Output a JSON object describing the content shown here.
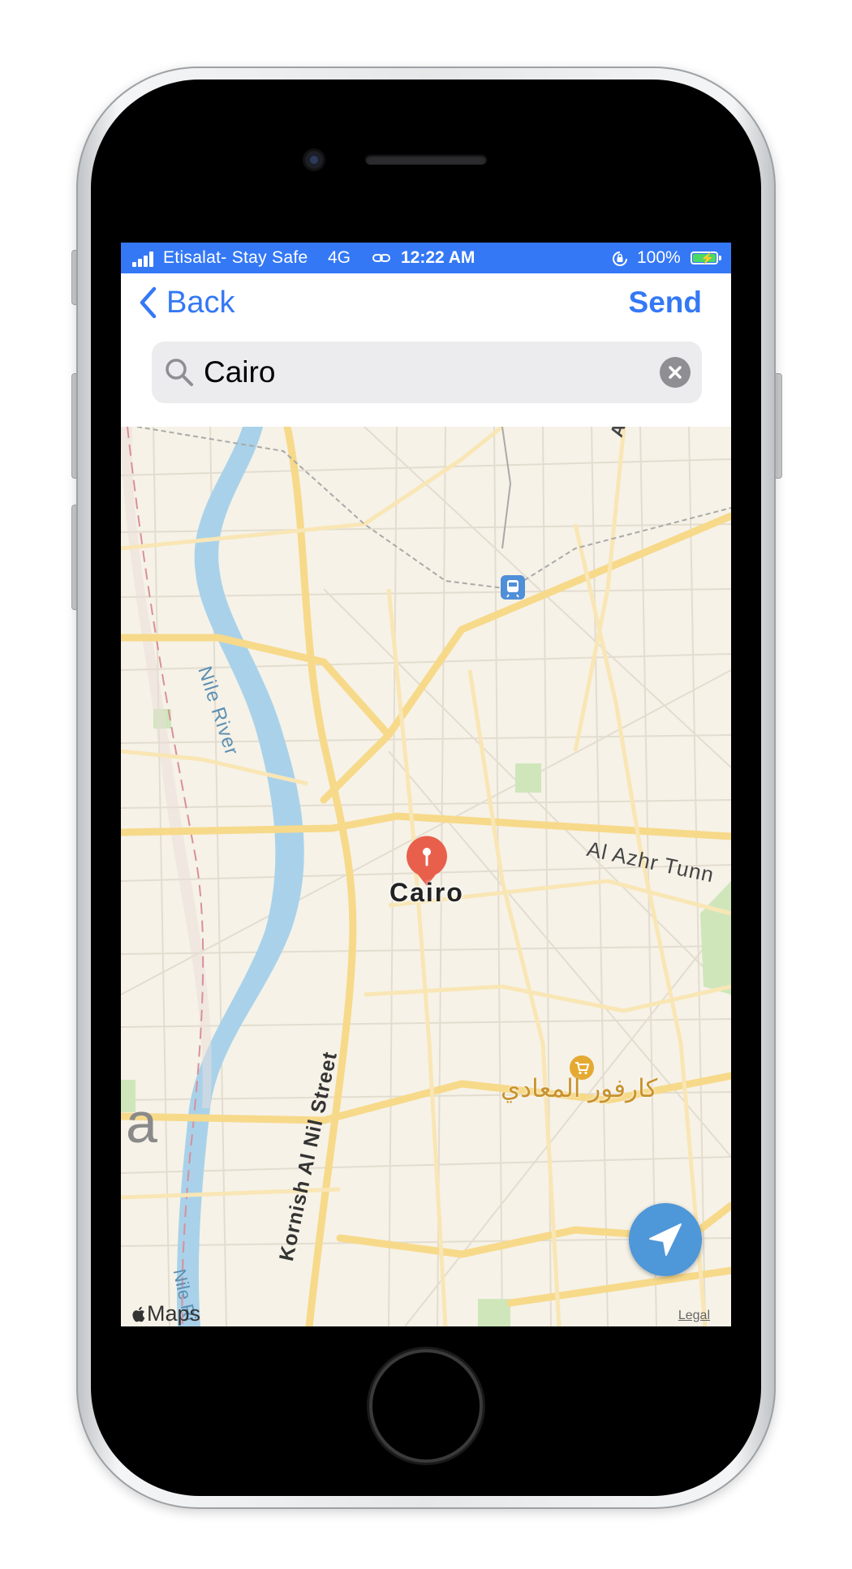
{
  "status_bar": {
    "carrier": "Etisalat- Stay Safe",
    "network": "4G",
    "time": "12:22 AM",
    "battery_percent": "100%",
    "background_color": "#3478f6"
  },
  "nav": {
    "back_label": "Back",
    "send_label": "Send",
    "accent_color": "#3478f6"
  },
  "search": {
    "value": "Cairo"
  },
  "map": {
    "city_label": "Cairo",
    "river_label": "Nile River",
    "river_label_2": "Nile Ri",
    "road_label_azhar": "Al Azhr Tunn",
    "road_label_kornish": "Kornish Al Nil Street",
    "road_label_top": "Ah",
    "poi_label": "كارفور المعادي",
    "edge_letter": "a",
    "attribution": "Maps",
    "legal_label": "Legal",
    "pin_color": "#e8604c",
    "water_color": "#a9d2ea"
  }
}
